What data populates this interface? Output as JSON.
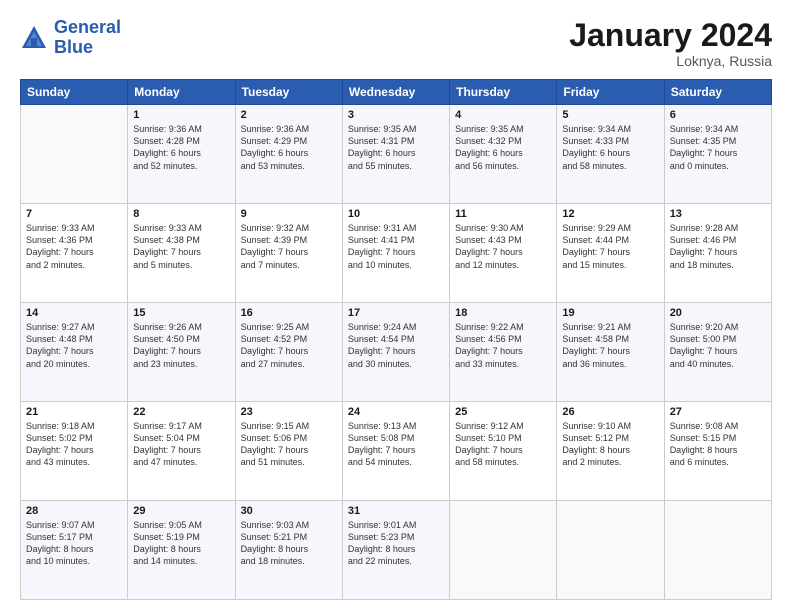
{
  "logo": {
    "line1": "General",
    "line2": "Blue"
  },
  "header": {
    "month": "January 2024",
    "location": "Loknya, Russia"
  },
  "weekdays": [
    "Sunday",
    "Monday",
    "Tuesday",
    "Wednesday",
    "Thursday",
    "Friday",
    "Saturday"
  ],
  "weeks": [
    [
      {
        "day": "",
        "info": ""
      },
      {
        "day": "1",
        "info": "Sunrise: 9:36 AM\nSunset: 4:28 PM\nDaylight: 6 hours\nand 52 minutes."
      },
      {
        "day": "2",
        "info": "Sunrise: 9:36 AM\nSunset: 4:29 PM\nDaylight: 6 hours\nand 53 minutes."
      },
      {
        "day": "3",
        "info": "Sunrise: 9:35 AM\nSunset: 4:31 PM\nDaylight: 6 hours\nand 55 minutes."
      },
      {
        "day": "4",
        "info": "Sunrise: 9:35 AM\nSunset: 4:32 PM\nDaylight: 6 hours\nand 56 minutes."
      },
      {
        "day": "5",
        "info": "Sunrise: 9:34 AM\nSunset: 4:33 PM\nDaylight: 6 hours\nand 58 minutes."
      },
      {
        "day": "6",
        "info": "Sunrise: 9:34 AM\nSunset: 4:35 PM\nDaylight: 7 hours\nand 0 minutes."
      }
    ],
    [
      {
        "day": "7",
        "info": "Sunrise: 9:33 AM\nSunset: 4:36 PM\nDaylight: 7 hours\nand 2 minutes."
      },
      {
        "day": "8",
        "info": "Sunrise: 9:33 AM\nSunset: 4:38 PM\nDaylight: 7 hours\nand 5 minutes."
      },
      {
        "day": "9",
        "info": "Sunrise: 9:32 AM\nSunset: 4:39 PM\nDaylight: 7 hours\nand 7 minutes."
      },
      {
        "day": "10",
        "info": "Sunrise: 9:31 AM\nSunset: 4:41 PM\nDaylight: 7 hours\nand 10 minutes."
      },
      {
        "day": "11",
        "info": "Sunrise: 9:30 AM\nSunset: 4:43 PM\nDaylight: 7 hours\nand 12 minutes."
      },
      {
        "day": "12",
        "info": "Sunrise: 9:29 AM\nSunset: 4:44 PM\nDaylight: 7 hours\nand 15 minutes."
      },
      {
        "day": "13",
        "info": "Sunrise: 9:28 AM\nSunset: 4:46 PM\nDaylight: 7 hours\nand 18 minutes."
      }
    ],
    [
      {
        "day": "14",
        "info": "Sunrise: 9:27 AM\nSunset: 4:48 PM\nDaylight: 7 hours\nand 20 minutes."
      },
      {
        "day": "15",
        "info": "Sunrise: 9:26 AM\nSunset: 4:50 PM\nDaylight: 7 hours\nand 23 minutes."
      },
      {
        "day": "16",
        "info": "Sunrise: 9:25 AM\nSunset: 4:52 PM\nDaylight: 7 hours\nand 27 minutes."
      },
      {
        "day": "17",
        "info": "Sunrise: 9:24 AM\nSunset: 4:54 PM\nDaylight: 7 hours\nand 30 minutes."
      },
      {
        "day": "18",
        "info": "Sunrise: 9:22 AM\nSunset: 4:56 PM\nDaylight: 7 hours\nand 33 minutes."
      },
      {
        "day": "19",
        "info": "Sunrise: 9:21 AM\nSunset: 4:58 PM\nDaylight: 7 hours\nand 36 minutes."
      },
      {
        "day": "20",
        "info": "Sunrise: 9:20 AM\nSunset: 5:00 PM\nDaylight: 7 hours\nand 40 minutes."
      }
    ],
    [
      {
        "day": "21",
        "info": "Sunrise: 9:18 AM\nSunset: 5:02 PM\nDaylight: 7 hours\nand 43 minutes."
      },
      {
        "day": "22",
        "info": "Sunrise: 9:17 AM\nSunset: 5:04 PM\nDaylight: 7 hours\nand 47 minutes."
      },
      {
        "day": "23",
        "info": "Sunrise: 9:15 AM\nSunset: 5:06 PM\nDaylight: 7 hours\nand 51 minutes."
      },
      {
        "day": "24",
        "info": "Sunrise: 9:13 AM\nSunset: 5:08 PM\nDaylight: 7 hours\nand 54 minutes."
      },
      {
        "day": "25",
        "info": "Sunrise: 9:12 AM\nSunset: 5:10 PM\nDaylight: 7 hours\nand 58 minutes."
      },
      {
        "day": "26",
        "info": "Sunrise: 9:10 AM\nSunset: 5:12 PM\nDaylight: 8 hours\nand 2 minutes."
      },
      {
        "day": "27",
        "info": "Sunrise: 9:08 AM\nSunset: 5:15 PM\nDaylight: 8 hours\nand 6 minutes."
      }
    ],
    [
      {
        "day": "28",
        "info": "Sunrise: 9:07 AM\nSunset: 5:17 PM\nDaylight: 8 hours\nand 10 minutes."
      },
      {
        "day": "29",
        "info": "Sunrise: 9:05 AM\nSunset: 5:19 PM\nDaylight: 8 hours\nand 14 minutes."
      },
      {
        "day": "30",
        "info": "Sunrise: 9:03 AM\nSunset: 5:21 PM\nDaylight: 8 hours\nand 18 minutes."
      },
      {
        "day": "31",
        "info": "Sunrise: 9:01 AM\nSunset: 5:23 PM\nDaylight: 8 hours\nand 22 minutes."
      },
      {
        "day": "",
        "info": ""
      },
      {
        "day": "",
        "info": ""
      },
      {
        "day": "",
        "info": ""
      }
    ]
  ]
}
